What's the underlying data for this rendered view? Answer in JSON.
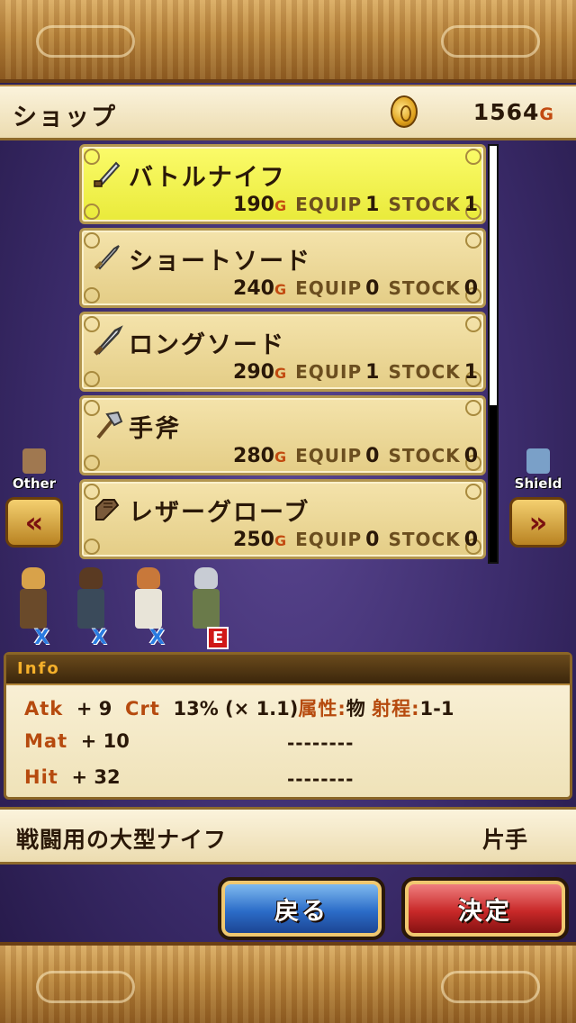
{
  "header": {
    "title": "ショップ",
    "gold_amount": "1564",
    "gold_unit": "G"
  },
  "items": [
    {
      "name": "バトルナイフ",
      "price": "190",
      "unit": "G",
      "equip_label": "EQUIP",
      "equip": "1",
      "stock_label": "STOCK",
      "stock": "1",
      "icon": "knife-icon",
      "selected": true
    },
    {
      "name": "ショートソード",
      "price": "240",
      "unit": "G",
      "equip_label": "EQUIP",
      "equip": "0",
      "stock_label": "STOCK",
      "stock": "0",
      "icon": "short-sword-icon",
      "selected": false
    },
    {
      "name": "ロングソード",
      "price": "290",
      "unit": "G",
      "equip_label": "EQUIP",
      "equip": "1",
      "stock_label": "STOCK",
      "stock": "1",
      "icon": "long-sword-icon",
      "selected": false
    },
    {
      "name": "手斧",
      "price": "280",
      "unit": "G",
      "equip_label": "EQUIP",
      "equip": "0",
      "stock_label": "STOCK",
      "stock": "0",
      "icon": "hand-axe-icon",
      "selected": false
    },
    {
      "name": "レザーグローブ",
      "price": "250",
      "unit": "G",
      "equip_label": "EQUIP",
      "equip": "0",
      "stock_label": "STOCK",
      "stock": "0",
      "icon": "leather-glove-icon",
      "selected": false
    }
  ],
  "nav": {
    "left_label": "Other",
    "right_label": "Shield",
    "left_arrow": "«",
    "right_arrow": "»"
  },
  "party": [
    {
      "mark": "X",
      "icon": "character-1-sprite"
    },
    {
      "mark": "X",
      "icon": "character-2-sprite"
    },
    {
      "mark": "X",
      "icon": "character-3-sprite"
    },
    {
      "mark": "E",
      "icon": "character-4-sprite"
    }
  ],
  "info": {
    "title": "Info",
    "atk_label": "Atk",
    "atk_value": "+ 9",
    "crt_label": "Crt",
    "crt_value": "13% (× 1.1)",
    "attr_label": "属性:",
    "attr_value": "物",
    "range_label": "射程:",
    "range_value": "1-1",
    "mat_label": "Mat",
    "mat_value": "+ 10",
    "hit_label": "Hit",
    "hit_value": "+ 32",
    "dash_1": "--------",
    "dash_2": "--------"
  },
  "description": {
    "text": "戦闘用の大型ナイフ",
    "hand": "片手"
  },
  "buttons": {
    "back": "戻る",
    "confirm": "決定"
  },
  "colors": {
    "selected_row": "#f0f050",
    "row": "#ecd896",
    "back_button": "#2b6cc8",
    "confirm_button": "#c82828",
    "accent_gold": "#c24a10"
  }
}
